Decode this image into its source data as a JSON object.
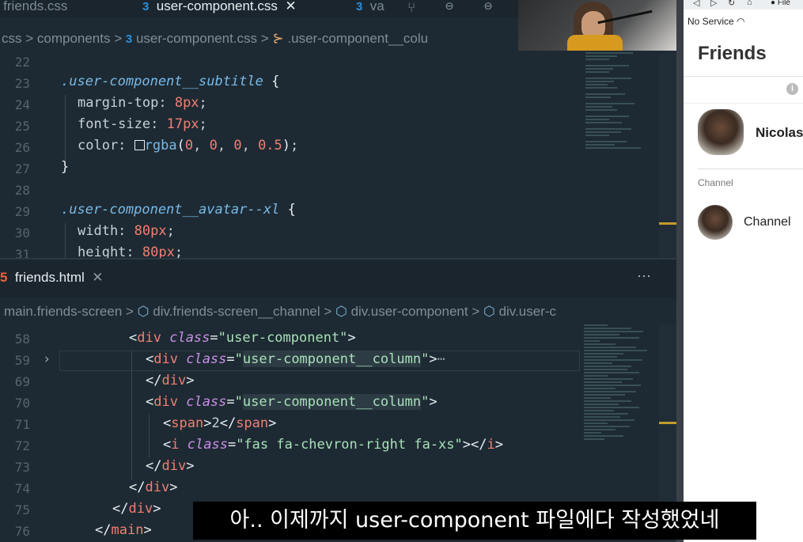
{
  "editor_top": {
    "tabs": [
      {
        "label": "friends.css",
        "active": false
      },
      {
        "label": "user-component.css",
        "active": true
      },
      {
        "label": "va",
        "active": false
      }
    ],
    "breadcrumb": [
      "css",
      "components",
      "user-component.css",
      ".user-component__colu"
    ],
    "lines": [
      "22",
      "23",
      "24",
      "25",
      "26",
      "27",
      "28",
      "29",
      "30",
      "31"
    ]
  },
  "editor_bottom": {
    "tab_label": "friends.html",
    "more_label": "···",
    "breadcrumb": [
      "main.friends-screen",
      "div.friends-screen__channel",
      "div.user-component",
      "div.user-c"
    ],
    "lines": [
      "58",
      "59",
      "69",
      "70",
      "71",
      "72",
      "73",
      "74",
      "75",
      "76"
    ]
  },
  "preview": {
    "status_text": "No Service",
    "browser_menu": "File",
    "title": "Friends",
    "user_name": "Nicolas",
    "section_label": "Channel",
    "channel_name": "Channel"
  },
  "subtitle": "아.. 이제까지 user-component 파일에다 작성했었네",
  "colors": {
    "editor_bg": "#1e2a33",
    "selector": "#78b9e8",
    "number": "#f07f74",
    "string": "#a7e2b8"
  }
}
